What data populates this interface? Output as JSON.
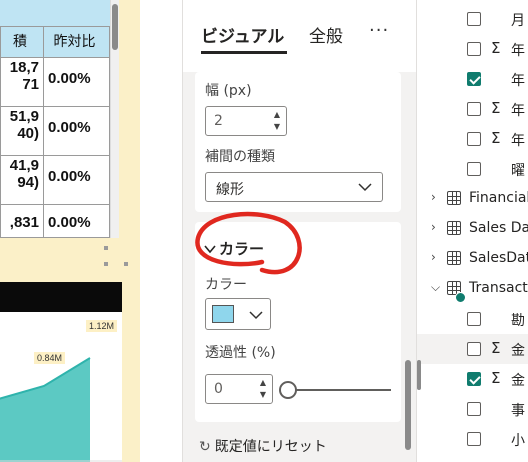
{
  "table": {
    "headers": [
      "積",
      "昨対比"
    ],
    "rows": [
      {
        "value": "18,7\n71",
        "pct": "0.00%"
      },
      {
        "value": "51,9\n40)",
        "pct": "0.00%"
      },
      {
        "value": "41,9\n94)",
        "pct": "0.00%"
      },
      {
        "value": ",831",
        "pct": "0.00%"
      }
    ]
  },
  "chart": {
    "labels": [
      "0.84M",
      "1.12M"
    ]
  },
  "chart_data": {
    "type": "area",
    "x": [
      1,
      2,
      3
    ],
    "values": [
      0.6,
      0.84,
      1.12
    ],
    "data_labels": [
      "0.84M",
      "1.12M"
    ],
    "colors": [
      "#5cc9c3"
    ]
  },
  "format_pane": {
    "tabs": {
      "visual": "ビジュアル",
      "general": "全般",
      "more": "···"
    },
    "width": {
      "label": "幅 (px)",
      "value": "2"
    },
    "interpolation": {
      "label": "補間の種類",
      "value": "線形"
    },
    "color_section": {
      "title": "カラー",
      "color_label": "カラー",
      "swatch_color": "#8fd6ec",
      "transparency_label": "透過性 (%)",
      "transparency_value": "0",
      "transparency_level": 0
    },
    "reset_label": "既定値にリセット"
  },
  "fields": {
    "items": [
      {
        "text": "月",
        "checked": false,
        "sigma": false
      },
      {
        "text": "年",
        "checked": false,
        "sigma": true
      },
      {
        "text": "年",
        "checked": true,
        "sigma": false
      },
      {
        "text": "年",
        "checked": false,
        "sigma": true
      },
      {
        "text": "年",
        "checked": false,
        "sigma": true
      },
      {
        "text": "曜",
        "checked": false,
        "sigma": false
      },
      {
        "text": "Financial",
        "table": true,
        "expanded": false
      },
      {
        "text": "Sales Dat",
        "table": true,
        "expanded": false
      },
      {
        "text": "SalesData",
        "table": true,
        "expanded": false
      },
      {
        "text": "Transactio",
        "table": true,
        "expanded": true
      },
      {
        "text": "勘",
        "checked": false,
        "sigma": false
      },
      {
        "text": "金",
        "checked": false,
        "sigma": true
      },
      {
        "text": "金",
        "checked": true,
        "sigma": true
      },
      {
        "text": "事",
        "checked": false,
        "sigma": false
      },
      {
        "text": "小",
        "checked": false,
        "sigma": false
      }
    ]
  }
}
